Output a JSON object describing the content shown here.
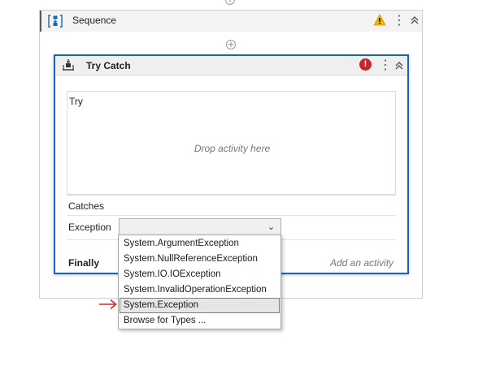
{
  "sequence": {
    "title": "Sequence"
  },
  "trycatch": {
    "title": "Try Catch",
    "error_badge": "!",
    "try_label": "Try",
    "drop_placeholder": "Drop activity here",
    "catches_label": "Catches",
    "exception_label": "Exception",
    "finally_label": "Finally",
    "add_activity": "Add an activity"
  },
  "dropdown": {
    "items": [
      "System.ArgumentException",
      "System.NullReferenceException",
      "System.IO.IOException",
      "System.InvalidOperationException",
      "System.Exception",
      "Browse for Types ..."
    ],
    "selected_index": 4
  },
  "icons": {
    "sequence": "sequence-activity-icon",
    "trycatch": "try-catch-activity-icon",
    "warning": "warning-icon",
    "error": "error-icon",
    "kebab": "more-options-icon",
    "collapse": "collapse-chevrons-icon",
    "add": "add-activity-plus-icon",
    "arrow": "red-pointer-arrow"
  },
  "colors": {
    "accent_border": "#1565c0",
    "error": "#c2282f",
    "warning": "#f2b600",
    "arrow": "#d9262b"
  }
}
